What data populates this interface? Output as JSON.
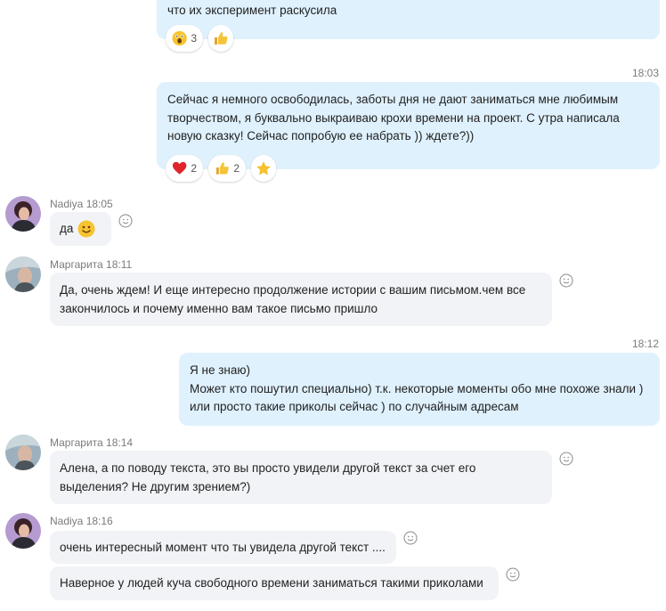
{
  "messages": {
    "m1": {
      "line1": "что их эксперимент раскусила"
    },
    "m1_reactions": {
      "r1_count": "3"
    },
    "m2": {
      "time": "18:03",
      "line1": "Сейчас я немного освободилась, заботы дня не дают заниматься мне любимым",
      "line2": "творчеством, я буквально выкраиваю крохи времени на проект. С утра написала",
      "line3": "новую сказку! Сейчас попробую ее набрать )) ждете?))"
    },
    "m2_reactions": {
      "heart_count": "2",
      "thumb_count": "2"
    },
    "m3": {
      "sender": "Nadiya",
      "time": "18:05",
      "text": "да"
    },
    "m4": {
      "sender": "Маргарита",
      "time": "18:11",
      "line1": "Да, очень ждем! И еще интересно продолжение истории с вашим письмом.чем все",
      "line2": "закончилось и почему именно вам такое письмо пришло"
    },
    "m5": {
      "time": "18:12",
      "line1": "Я не знаю)",
      "line2": "Может кто пошутил специально) т.к. некоторые моменты обо мне похоже знали )",
      "line3": "или просто такие приколы сейчас ) по случайным адресам"
    },
    "m6": {
      "sender": "Маргарита",
      "time": "18:14",
      "line1": "Алена, а по поводу текста, это вы просто увидели другой текст за счет его",
      "line2": "выделения? Не другим зрением?)"
    },
    "m7": {
      "sender": "Nadiya",
      "time": "18:16",
      "text1": "очень интересный момент что ты увидела другой текст ....",
      "text2": "Наверное у людей куча свободного времени заниматься такими приколами"
    }
  },
  "colors": {
    "outgoing_bubble": "#dff1fd",
    "incoming_bubble": "#f1f3f6",
    "timestamp": "#7b7b7b"
  },
  "icons": [
    "react-smiley-icon",
    "shocked-emoji-icon",
    "thumbs-up-icon",
    "heart-icon",
    "star-icon",
    "smile-emoji-icon"
  ]
}
